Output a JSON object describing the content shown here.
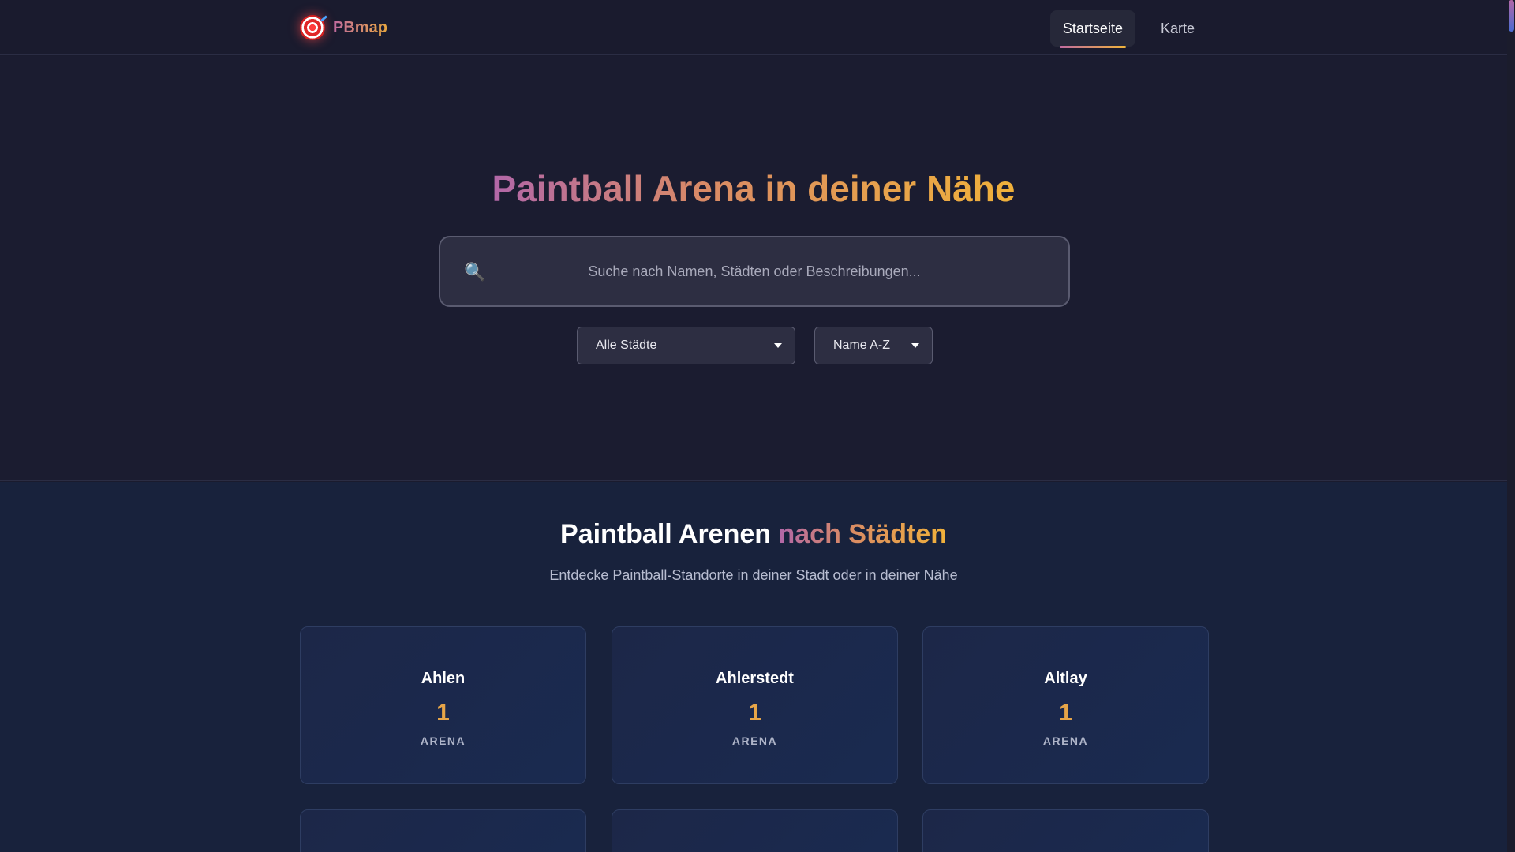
{
  "brand": {
    "name": "PBmap",
    "icon": "target-icon"
  },
  "nav": {
    "items": [
      {
        "label": "Startseite",
        "active": true
      },
      {
        "label": "Karte",
        "active": false
      }
    ]
  },
  "hero": {
    "title": "Paintball Arena in deiner Nähe",
    "search": {
      "placeholder": "Suche nach Namen, Städten oder Beschreibungen...",
      "value": "",
      "icon": "search-icon"
    },
    "filters": {
      "city": "Alle Städte",
      "sort": "Name A-Z"
    }
  },
  "cities": {
    "title_plain": "Paintball Arenen",
    "title_gradient": "nach Städten",
    "subtitle": "Entdecke Paintball-Standorte in deiner Stadt oder in deiner Nähe",
    "cards": [
      {
        "name": "Ahlen",
        "count": "1",
        "unit": "ARENA"
      },
      {
        "name": "Ahlerstedt",
        "count": "1",
        "unit": "ARENA"
      },
      {
        "name": "Altlay",
        "count": "1",
        "unit": "ARENA"
      }
    ]
  },
  "colors": {
    "background": "#1a1b2e",
    "accent_pink": "#c06ba0",
    "accent_gold": "#f0b13a",
    "section_bg": "#18223c"
  }
}
